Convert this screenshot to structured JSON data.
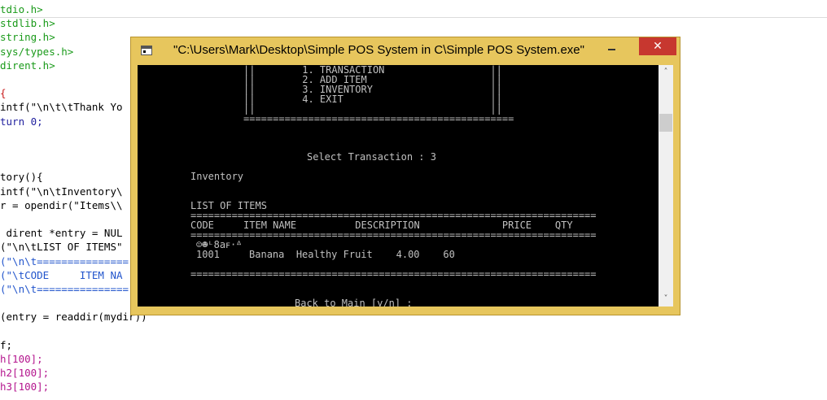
{
  "editor": {
    "lines": [
      {
        "text": "tdio.h>",
        "cls": "c-inc"
      },
      {
        "text": "stdlib.h>",
        "cls": "c-inc"
      },
      {
        "text": "string.h>",
        "cls": "c-inc"
      },
      {
        "text": "sys/types.h>",
        "cls": "c-inc"
      },
      {
        "text": "dirent.h>",
        "cls": "c-inc"
      },
      {
        "text": "",
        "cls": "c-blk"
      },
      {
        "text": "{",
        "cls": "c-red"
      },
      {
        "text": "intf(\"\\n\\t\\tThank Yo",
        "cls": "c-blk"
      },
      {
        "text": "turn 0;",
        "cls": "c-kw"
      },
      {
        "text": "",
        "cls": "c-blk"
      },
      {
        "text": "",
        "cls": "c-blk"
      },
      {
        "text": "",
        "cls": "c-blk"
      },
      {
        "text": "tory(){",
        "cls": "c-blk"
      },
      {
        "text": "intf(\"\\n\\tInventory\\",
        "cls": "c-blk"
      },
      {
        "text": "r = opendir(\"Items\\\\",
        "cls": "c-blk"
      },
      {
        "text": "",
        "cls": "c-blk"
      },
      {
        "text": " dirent *entry = NUL",
        "cls": "c-blk"
      },
      {
        "text": "(\"\\n\\tLIST OF ITEMS\"",
        "cls": "c-blk"
      },
      {
        "text": "(\"\\n\\t===============",
        "cls": "c-str"
      },
      {
        "text": "(\"\\tCODE     ITEM NA",
        "cls": "c-str"
      },
      {
        "text": "(\"\\n\\t===============",
        "cls": "c-str"
      },
      {
        "text": "",
        "cls": "c-blk"
      },
      {
        "text": "(entry = readdir(mydir))",
        "cls": "c-blk"
      },
      {
        "text": "",
        "cls": "c-blk"
      },
      {
        "text": "f;",
        "cls": "c-blk"
      },
      {
        "text": "h[100];",
        "cls": "c-num"
      },
      {
        "text": "h2[100];",
        "cls": "c-num"
      },
      {
        "text": "h3[100];",
        "cls": "c-num"
      }
    ]
  },
  "window": {
    "title": "\"C:\\Users\\Mark\\Desktop\\Simple POS System in C\\Simple POS System.exe\"",
    "minimize_glyph": "",
    "close_glyph": "✕",
    "accent": "#e7c65d",
    "close_color": "#c7372f"
  },
  "console": {
    "menu_lines": [
      "||        1. TRANSACTION                  ||",
      "||        2. ADD ITEM                     ||",
      "||        3. INVENTORY                    ||",
      "||        4. EXIT                         ||",
      "||                                        ||",
      "=============================================="
    ],
    "select_prompt": "Select Transaction : 3",
    "inventory_heading": "Inventory",
    "list_heading": "LIST OF ITEMS",
    "separator": "=====================================================================",
    "header_line": "CODE     ITEM NAME          DESCRIPTION              PRICE    QTY",
    "garbage_line": "☺☻ᴸ8aꜰ·ᐞ",
    "item_line": "1001     Banana  Healthy Fruit    4.00    60",
    "back_prompt": "Back to Main [y/n] :"
  },
  "scrollbar": {
    "up_glyph": "˄",
    "down_glyph": "˅"
  }
}
